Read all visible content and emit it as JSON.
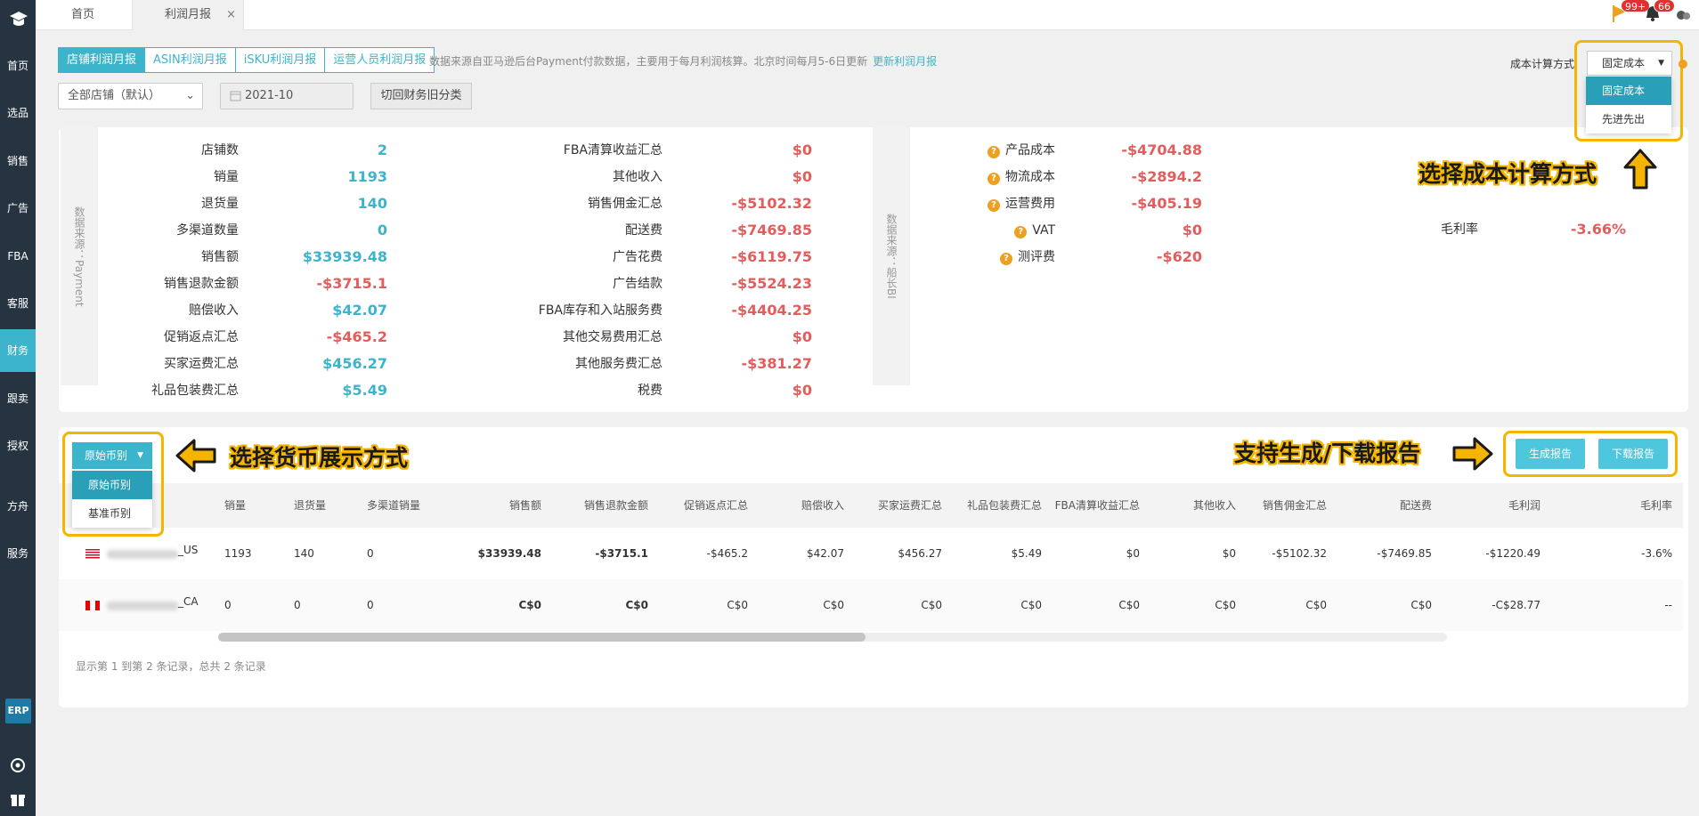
{
  "sidebar": {
    "items": [
      "首页",
      "选品",
      "销售",
      "广告",
      "FBA",
      "客服",
      "财务",
      "跟卖",
      "授权",
      "方舟",
      "服务"
    ],
    "active": "财务",
    "erp": "ERP"
  },
  "topbar": {
    "tabs": [
      "首页",
      "利润月报"
    ],
    "close": "×",
    "flag_badge": "99+",
    "bell_badge": "66"
  },
  "report_tabs": [
    "店铺利润月报",
    "ASIN利润月报",
    "iSKU利润月报",
    "运营人员利润月报"
  ],
  "note": {
    "text": "数据来源自亚马逊后台Payment付款数据，主要用于每月利润核算。北京时间每月5-6日更新",
    "link": "更新利润月报"
  },
  "filters": {
    "store": "全部店铺（默认）",
    "month": "2021-10",
    "switch": "切回财务旧分类"
  },
  "cost": {
    "label": "成本计算方式",
    "selected": "固定成本",
    "options": [
      "固定成本",
      "先进先出"
    ]
  },
  "summary": {
    "side_a": "数据来源：Payment",
    "side_b": "数据来源：船长BI",
    "col1": [
      [
        "店铺数",
        "2"
      ],
      [
        "销量",
        "1193"
      ],
      [
        "退货量",
        "140"
      ],
      [
        "多渠道数量",
        "0"
      ],
      [
        "销售额",
        "$33939.48"
      ],
      [
        "销售退款金额",
        "-$3715.1"
      ],
      [
        "赔偿收入",
        "$42.07"
      ],
      [
        "促销返点汇总",
        "-$465.2"
      ],
      [
        "买家运费汇总",
        "$456.27"
      ],
      [
        "礼品包装费汇总",
        "$5.49"
      ]
    ],
    "col2": [
      [
        "FBA清算收益汇总",
        "$0"
      ],
      [
        "其他收入",
        "$0"
      ],
      [
        "销售佣金汇总",
        "-$5102.32"
      ],
      [
        "配送费",
        "-$7469.85"
      ],
      [
        "广告花费",
        "-$6119.75"
      ],
      [
        "广告结款",
        "-$5524.23"
      ],
      [
        "FBA库存和入站服务费",
        "-$4404.25"
      ],
      [
        "其他交易费用汇总",
        "$0"
      ],
      [
        "其他服务费汇总",
        "-$381.27"
      ],
      [
        "税费",
        "$0"
      ]
    ],
    "col3": [
      [
        "产品成本",
        "-$4704.88"
      ],
      [
        "物流成本",
        "-$2894.2"
      ],
      [
        "运营费用",
        "-$405.19"
      ],
      [
        "VAT",
        "$0"
      ],
      [
        "测评费",
        "-$620"
      ]
    ],
    "margin_label": "毛利率",
    "margin_value": "-3.66%"
  },
  "annotations": {
    "cost": "选择成本计算方式",
    "currency": "选择货币展示方式",
    "report": "支持生成/下载报告"
  },
  "currency": {
    "selected": "原始币别",
    "options": [
      "原始币别",
      "基准币别"
    ]
  },
  "buttons": {
    "generate": "生成报告",
    "download": "下载报告"
  },
  "table": {
    "headers": [
      "销量",
      "退货量",
      "多渠道销量",
      "销售额",
      "销售退款金额",
      "促销返点汇总",
      "赔偿收入",
      "买家运费汇总",
      "礼品包装费汇总",
      "FBA清算收益汇总",
      "其他收入",
      "销售佣金汇总",
      "配送费",
      "毛利润",
      "毛利率"
    ],
    "rows": [
      {
        "store": "_US",
        "cells": [
          "1193",
          "140",
          "0",
          "$33939.48",
          "-$3715.1",
          "-$465.2",
          "$42.07",
          "$456.27",
          "$5.49",
          "$0",
          "$0",
          "-$5102.32",
          "-$7469.85",
          "-$1220.49",
          "-3.6%"
        ]
      },
      {
        "store": "_CA",
        "cells": [
          "0",
          "0",
          "0",
          "C$0",
          "C$0",
          "C$0",
          "C$0",
          "C$0",
          "C$0",
          "C$0",
          "C$0",
          "C$0",
          "C$0",
          "-C$28.77",
          "--"
        ]
      }
    ],
    "footer": "显示第 1 到第 2 条记录，总共 2 条记录"
  }
}
